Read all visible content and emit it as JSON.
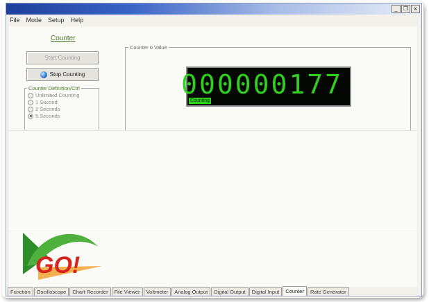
{
  "window": {
    "controls": [
      "_",
      "7",
      "×"
    ]
  },
  "menu": [
    "File",
    "Mode",
    "Setup",
    "Help"
  ],
  "counter": {
    "title": "Counter",
    "start_button": "Start Counting",
    "stop_button": "Stop Counting",
    "duration_group": {
      "legend": "Counter Definition/Ctrl",
      "options": [
        {
          "label": "Unlimited Counting",
          "selected": false
        },
        {
          "label": "1 Second",
          "selected": false
        },
        {
          "label": "2 Seconds",
          "selected": false
        },
        {
          "label": "5 Seconds",
          "selected": true
        }
      ]
    },
    "value_group": {
      "legend": "Counter 0 Value",
      "display": "000000177",
      "status": "Counting"
    }
  },
  "logo": {
    "text": "GO!"
  },
  "tabs": [
    {
      "label": "Function",
      "active": false
    },
    {
      "label": "Oscilloscope",
      "active": false
    },
    {
      "label": "Chart Recorder",
      "active": false
    },
    {
      "label": "File Viewer",
      "active": false
    },
    {
      "label": "Voltmeter",
      "active": false
    },
    {
      "label": "Analog Output",
      "active": false
    },
    {
      "label": "Digital Output",
      "active": false
    },
    {
      "label": "Digital Input",
      "active": false
    },
    {
      "label": "Counter",
      "active": true
    },
    {
      "label": "Rate Generator",
      "active": false
    }
  ],
  "colors": {
    "lcd_green": "#2fd11e",
    "label_green": "#4a7a2a",
    "titlebar_blue": "#1e3f9a"
  }
}
